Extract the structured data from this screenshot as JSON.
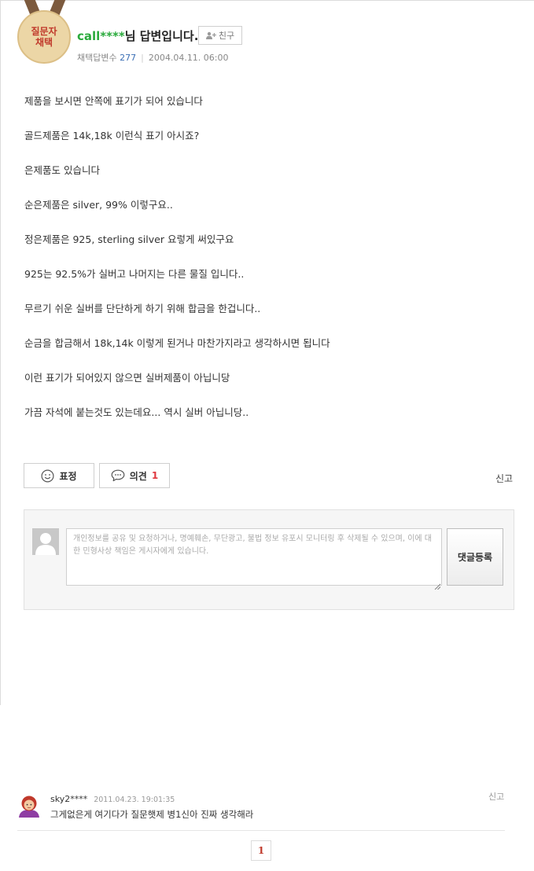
{
  "answer": {
    "badge_line1": "질문자",
    "badge_line2": "채택",
    "user_id": "call****",
    "title_suffix": "님 답변입니다.",
    "friend_label": "친구",
    "adopted_label": "채택답변수",
    "adopted_count": "277",
    "date": "2004.04.11. 06:00",
    "paragraphs": [
      "제품을 보시면 안쪽에 표기가 되어 있습니다",
      "골드제품은 14k,18k 이런식 표기 아시죠?",
      "은제품도 있습니다",
      "순은제품은 silver, 99% 이렇구요..",
      "정은제품은 925, sterling silver 요렇게 써있구요",
      "925는 92.5%가 실버고 나머지는 다른 물질 입니다..",
      "무르기 쉬운 실버를 단단하게 하기 위해 합금을 한겁니다..",
      "순금을 합금해서 18k,14k 이렇게 된거나 마찬가지라고 생각하시면 됩니다",
      "이런 표기가 되어있지 않으면 실버제품이 아닙니당",
      "가끔 자석에 붙는것도 있는데요... 역시 실버 아닙니당.."
    ]
  },
  "actions": {
    "expression_label": "표정",
    "opinion_label": "의견",
    "opinion_count": "1",
    "report_label": "신고"
  },
  "comment_form": {
    "placeholder": "개인정보를 공유 및 요청하거나, 명예훼손, 무단광고, 불법 정보 유포시 모니터링 후 삭제될 수 있으며, 이에 대한 민형사상 책임은 게시자에게 있습니다.",
    "submit_label": "댓글등록"
  },
  "replies": [
    {
      "user": "sky2****",
      "time": "2011.04.23. 19:01:35",
      "text": "그게없은게 여기다가 질문햇제 병1신아 진짜 생각해라",
      "report_label": "신고"
    }
  ],
  "pagination": {
    "current": "1"
  }
}
